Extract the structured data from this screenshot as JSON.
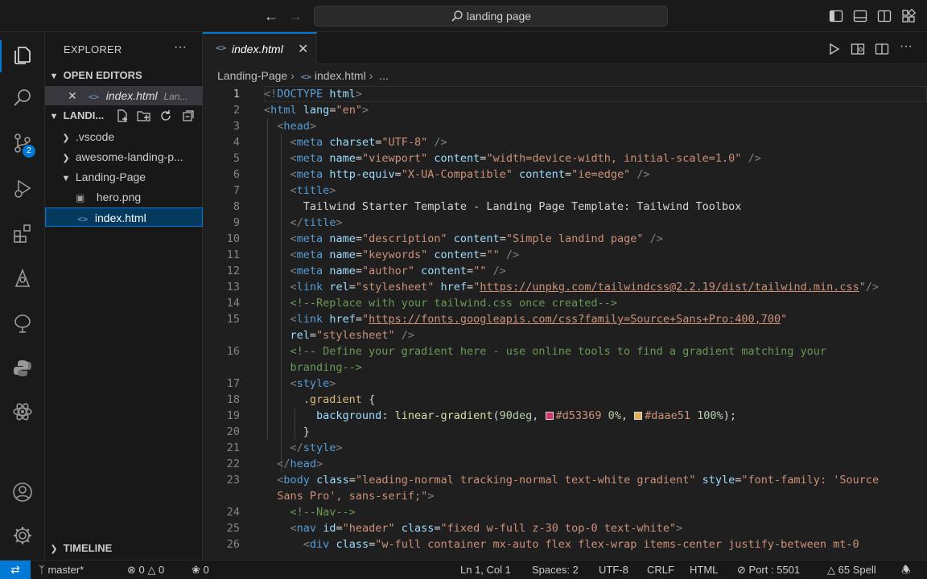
{
  "titlebar": {
    "search_text": "landing page"
  },
  "activity_bar": {
    "scm_badge": "2"
  },
  "sidebar": {
    "title": "EXPLORER",
    "more": "···",
    "open_editors": {
      "header": "OPEN EDITORS",
      "items": [
        {
          "name": "index.html",
          "path": "Lan..."
        }
      ]
    },
    "folder": {
      "header": "LANDI...",
      "items": [
        {
          "label": ".vscode",
          "kind": "folder",
          "expanded": false
        },
        {
          "label": "awesome-landing-p...",
          "kind": "folder",
          "expanded": false
        },
        {
          "label": "Landing-Page",
          "kind": "folder",
          "expanded": true
        },
        {
          "label": "hero.png",
          "kind": "image"
        },
        {
          "label": "index.html",
          "kind": "html",
          "selected": true
        }
      ]
    },
    "timeline": {
      "header": "TIMELINE"
    }
  },
  "editor": {
    "tab": {
      "label": "index.html"
    },
    "breadcrumb": {
      "folder": "Landing-Page",
      "file": "index.html",
      "more": "..."
    }
  },
  "code": {
    "line_numbers": [
      "1",
      "2",
      "3",
      "4",
      "5",
      "6",
      "7",
      "8",
      "9",
      "10",
      "11",
      "12",
      "13",
      "14",
      "15",
      "",
      "16",
      "",
      "17",
      "18",
      "19",
      "20",
      "21",
      "22",
      "23",
      "",
      "24",
      "25",
      "26"
    ],
    "current_line": "1"
  },
  "statusbar": {
    "branch": "master*",
    "errors": "0",
    "warnings": "0",
    "ports_forwarded": "0",
    "cursor": "Ln 1, Col 1",
    "indent": "Spaces: 2",
    "encoding": "UTF-8",
    "eol": "CRLF",
    "language": "HTML",
    "port": "Port : 5501",
    "spell": "65 Spell"
  },
  "colors": {
    "accent": "#0078d4",
    "gradient_start": "#d53369",
    "gradient_end": "#daae51"
  }
}
